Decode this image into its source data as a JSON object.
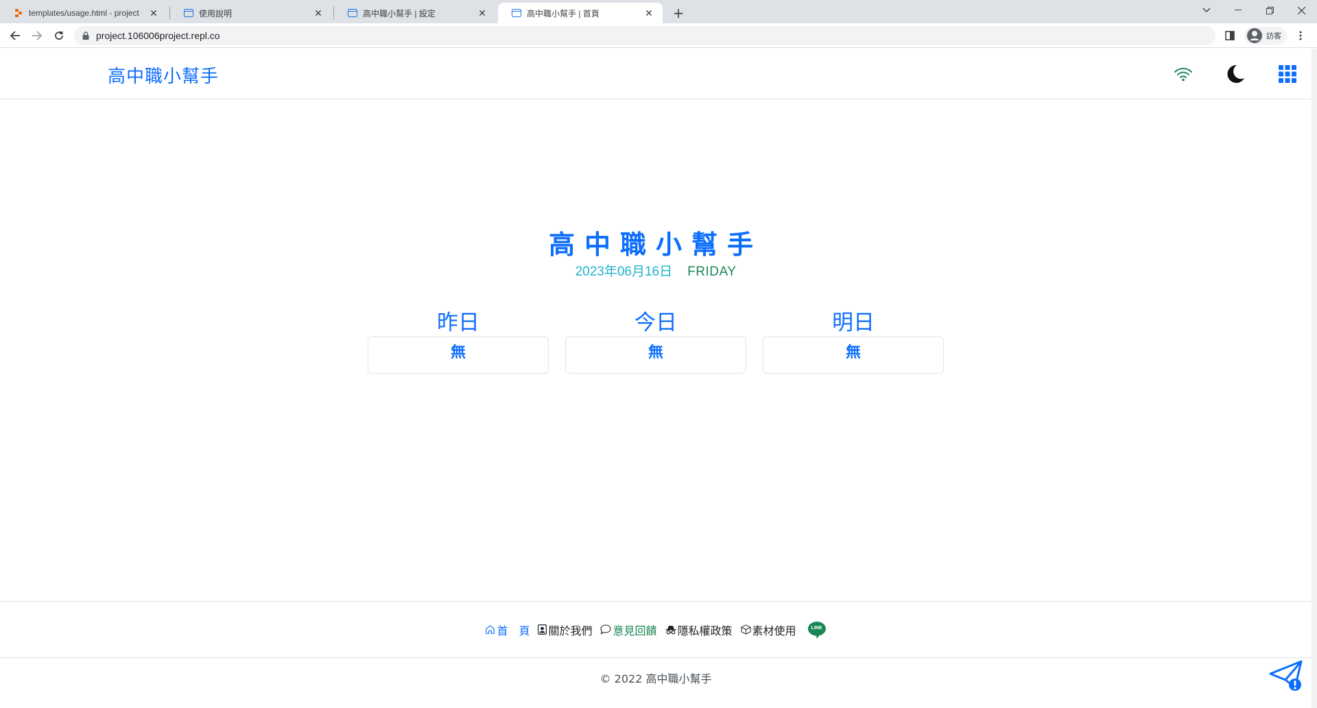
{
  "browser": {
    "tabs": [
      {
        "title": "templates/usage.html - project",
        "icon": "replit-icon"
      },
      {
        "title": "使用說明",
        "icon": "page-icon"
      },
      {
        "title": "高中職小幫手 | 設定",
        "icon": "page-icon"
      },
      {
        "title": "高中職小幫手 | 首頁",
        "icon": "page-icon"
      }
    ],
    "url": "project.106006project.repl.co",
    "profile_label": "訪客"
  },
  "site": {
    "brand": "高中職小幫手",
    "hero_title": "高中職小幫手",
    "date": "2023年06月16日",
    "weekday": "FRIDAY",
    "columns": [
      {
        "heading": "昨日",
        "value": "無"
      },
      {
        "heading": "今日",
        "value": "無"
      },
      {
        "heading": "明日",
        "value": "無"
      }
    ],
    "footer_links": {
      "home": "首　頁",
      "about": "關於我們",
      "feedback": "意見回饋",
      "privacy": "隱私權政策",
      "assets": "素材使用",
      "line": "LINE"
    },
    "copyright": "© 2022 高中職小幫手"
  },
  "colors": {
    "primary": "#0d6efd",
    "success": "#198754",
    "info": "#20b2c9"
  }
}
